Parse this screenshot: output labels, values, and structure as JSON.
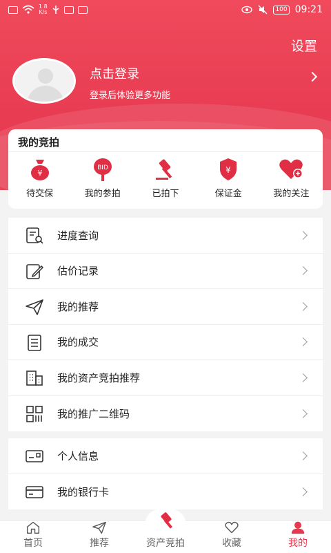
{
  "status_bar": {
    "speed_value": "1.8",
    "speed_unit": "K/s",
    "battery": "100",
    "time": "09:21"
  },
  "header": {
    "settings_label": "设置",
    "login_title": "点击登录",
    "login_subtitle": "登录后体验更多功能"
  },
  "auction_card": {
    "title": "我的竞拍",
    "items": [
      {
        "label": "待交保",
        "icon": "money-bag-icon"
      },
      {
        "label": "我的参拍",
        "icon": "bid-paddle-icon"
      },
      {
        "label": "已拍下",
        "icon": "gavel-icon"
      },
      {
        "label": "保证金",
        "icon": "shield-yen-icon"
      },
      {
        "label": "我的关注",
        "icon": "heart-plus-icon"
      }
    ]
  },
  "menu_main": [
    {
      "label": "进度查询",
      "icon": "document-search-icon"
    },
    {
      "label": "估价记录",
      "icon": "edit-note-icon"
    },
    {
      "label": "我的推荐",
      "icon": "paper-plane-icon"
    },
    {
      "label": "我的成交",
      "icon": "list-document-icon"
    },
    {
      "label": "我的资产竞拍推荐",
      "icon": "building-icon"
    },
    {
      "label": "我的推广二维码",
      "icon": "qr-code-icon"
    }
  ],
  "menu_account": [
    {
      "label": "个人信息",
      "icon": "id-card-icon"
    },
    {
      "label": "我的银行卡",
      "icon": "bank-card-icon"
    }
  ],
  "bottom_nav": [
    {
      "label": "首页",
      "icon": "home-icon"
    },
    {
      "label": "推荐",
      "icon": "paper-plane-icon"
    },
    {
      "label": "资产竞拍",
      "icon": "gavel-icon"
    },
    {
      "label": "收藏",
      "icon": "heart-icon"
    },
    {
      "label": "我的",
      "icon": "user-icon"
    }
  ],
  "colors": {
    "brand": "#e6384e",
    "icon_red": "#e02f45"
  }
}
